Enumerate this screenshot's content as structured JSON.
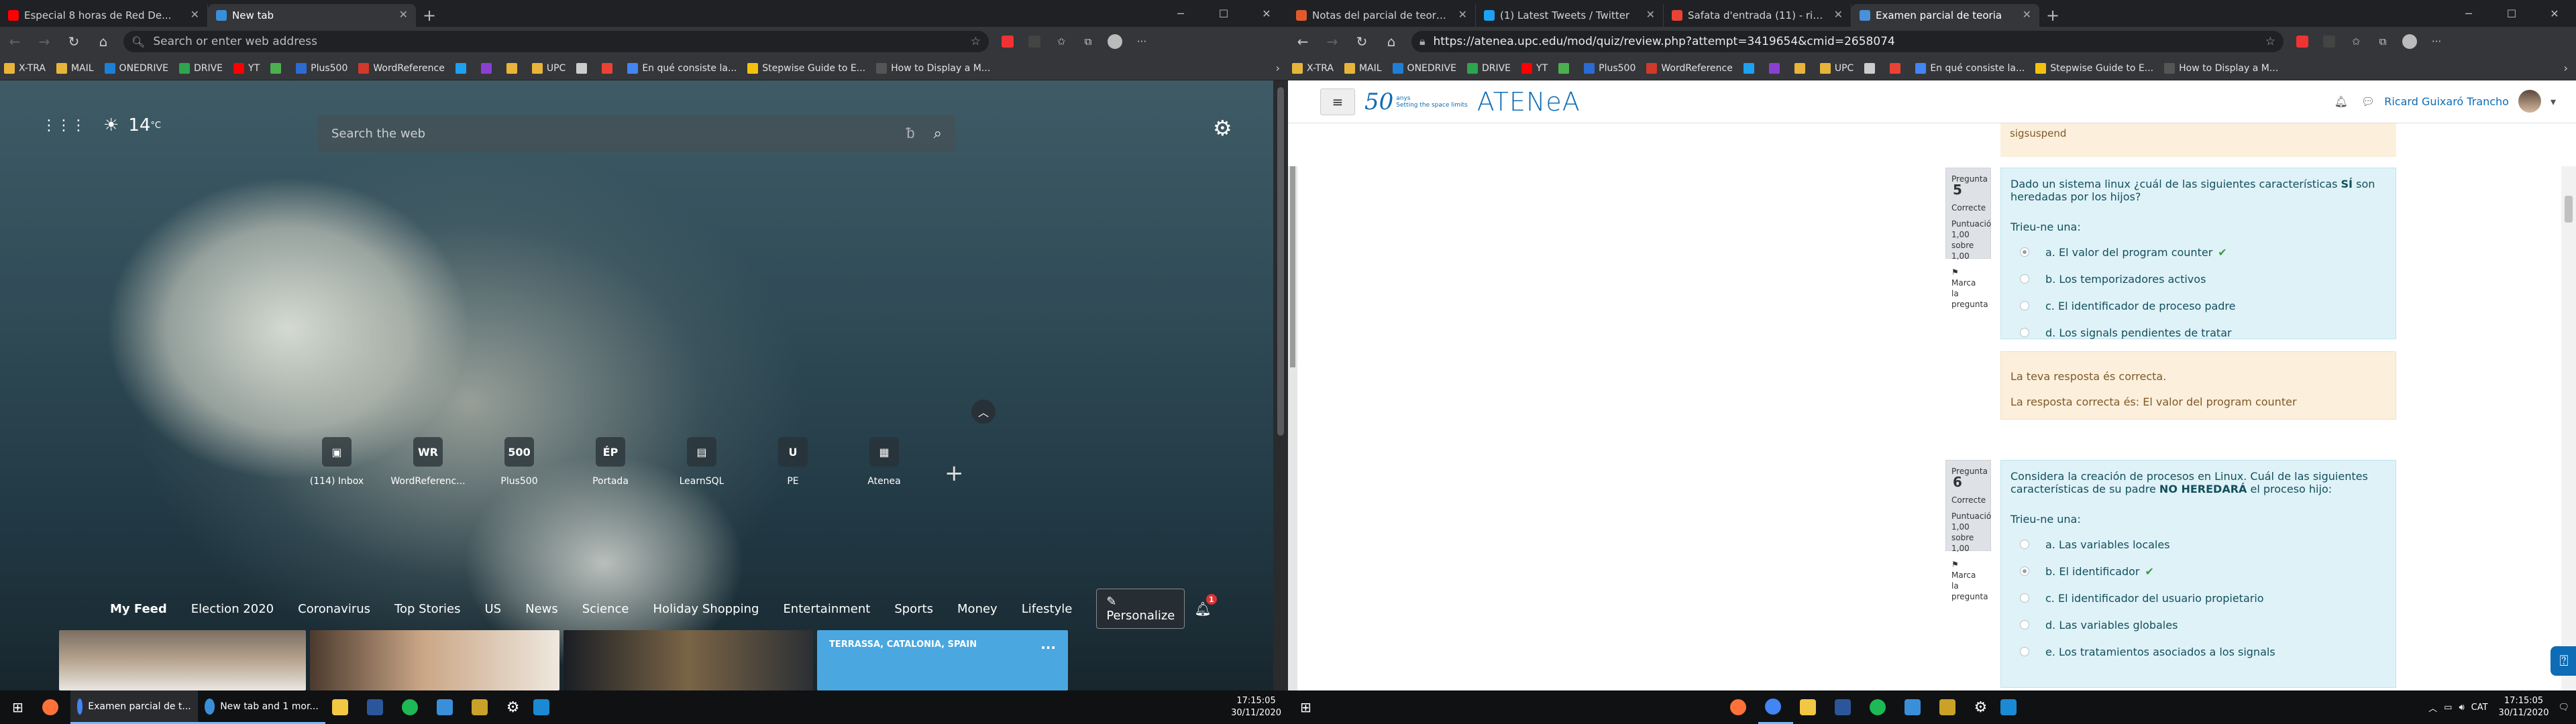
{
  "left_window": {
    "tabs": [
      {
        "label": "Especial 8 horas de Red De...",
        "color": "#ff0000",
        "active": false
      },
      {
        "label": "New tab",
        "color": "#3a8fd9",
        "active": true
      }
    ],
    "omnibox_placeholder": "Search or enter web address",
    "bookmarks": [
      {
        "label": "X-TRA",
        "color": "#e8b53a"
      },
      {
        "label": "MAIL",
        "color": "#e8b53a"
      },
      {
        "label": "ONEDRIVE",
        "color": "#1e7fd6"
      },
      {
        "label": "DRIVE",
        "color": "#2da44e"
      },
      {
        "label": "YT",
        "color": "#ff0000"
      },
      {
        "label": "",
        "color": "#4caf50"
      },
      {
        "label": "Plus500",
        "color": "#2a6bd4"
      },
      {
        "label": "WordReference",
        "color": "#d0392b"
      },
      {
        "label": "",
        "color": "#1da1f2"
      },
      {
        "label": "",
        "color": "#8b3fd1"
      },
      {
        "label": "",
        "color": "#e8b53a"
      },
      {
        "label": "UPC",
        "color": "#e8b53a"
      },
      {
        "label": "",
        "color": "#cccccc"
      },
      {
        "label": "",
        "color": "#ea4335"
      },
      {
        "label": "En qué consiste la...",
        "color": "#4285f4"
      },
      {
        "label": "Stepwise Guide to E...",
        "color": "#f4c20d"
      },
      {
        "label": "How to Display a M...",
        "color": "#555555"
      }
    ],
    "weather": {
      "temp": "14",
      "unit": "°C"
    },
    "search_placeholder": "Search the web",
    "tiles": [
      {
        "label": "(114) Inbox",
        "glyph": "▣"
      },
      {
        "label": "WordReferenc...",
        "glyph": "WR"
      },
      {
        "label": "Plus500",
        "glyph": "500"
      },
      {
        "label": "Portada",
        "glyph": "ÉP"
      },
      {
        "label": "LearnSQL",
        "glyph": "▤"
      },
      {
        "label": "PE",
        "glyph": "U"
      },
      {
        "label": "Atenea",
        "glyph": "▦"
      }
    ],
    "feed_nav": [
      "My Feed",
      "Election 2020",
      "Coronavirus",
      "Top Stories",
      "US",
      "News",
      "Science",
      "Holiday Shopping",
      "Entertainment",
      "Sports",
      "Money",
      "Lifestyle"
    ],
    "personalize_label": "Personalize",
    "notif_count": "1",
    "weather_card": {
      "location": "TERRASSA, CATALONIA, SPAIN",
      "more": "···"
    },
    "taskbar": {
      "items": [
        {
          "label": "Examen parcial de t...",
          "color": "#4285f4"
        },
        {
          "label": "New tab and 1 mor...",
          "color": "#3a8fd9"
        }
      ],
      "time": "17:15:05",
      "date": "30/11/2020"
    }
  },
  "right_window": {
    "tabs": [
      {
        "label": "Notas del parcial de teoria - Ra...",
        "color": "#e05a2b",
        "active": false
      },
      {
        "label": "(1) Latest Tweets / Twitter",
        "color": "#1da1f2",
        "active": false
      },
      {
        "label": "Safata d'entrada (11) - ricard.gu...",
        "color": "#ea4335",
        "active": false
      },
      {
        "label": "Examen parcial de teoria",
        "color": "#4a90d9",
        "active": true
      }
    ],
    "url": "https://atenea.upc.edu/mod/quiz/review.php?attempt=3419654&cmid=2658074",
    "bookmarks": [
      {
        "label": "X-TRA",
        "color": "#e8b53a"
      },
      {
        "label": "MAIL",
        "color": "#e8b53a"
      },
      {
        "label": "ONEDRIVE",
        "color": "#1e7fd6"
      },
      {
        "label": "DRIVE",
        "color": "#2da44e"
      },
      {
        "label": "YT",
        "color": "#ff0000"
      },
      {
        "label": "",
        "color": "#4caf50"
      },
      {
        "label": "Plus500",
        "color": "#2a6bd4"
      },
      {
        "label": "WordReference",
        "color": "#d0392b"
      },
      {
        "label": "",
        "color": "#1da1f2"
      },
      {
        "label": "",
        "color": "#8b3fd1"
      },
      {
        "label": "",
        "color": "#e8b53a"
      },
      {
        "label": "UPC",
        "color": "#e8b53a"
      },
      {
        "label": "",
        "color": "#cccccc"
      },
      {
        "label": "",
        "color": "#ea4335"
      },
      {
        "label": "En qué consiste la...",
        "color": "#4285f4"
      },
      {
        "label": "Stepwise Guide to E...",
        "color": "#f4c20d"
      },
      {
        "label": "How to Display a M...",
        "color": "#555555"
      }
    ],
    "logo": {
      "anys": "50",
      "anys_label": "anys",
      "tagline": "Setting the\nspace limits",
      "name": "ATENeA"
    },
    "user_name": "Ricard Guixaró Trancho",
    "prev_feedback_tail": "sigsuspend",
    "questions": [
      {
        "label": "Pregunta",
        "number": "5",
        "status": "Correcte",
        "grade": "Puntuació 1,00 sobre 1,00",
        "flag": "Marca la pregunta",
        "text_before": "Dado un sistema linux ¿cuál de las siguientes características ",
        "text_bold": "SÍ",
        "text_after": " son heredadas por los hijos?",
        "prompt": "Trieu-ne una:",
        "options": [
          {
            "label": "a. El valor del program counter",
            "selected": true,
            "correct": true
          },
          {
            "label": "b. Los temporizadores activos",
            "selected": false,
            "correct": false
          },
          {
            "label": "c. El identificador de proceso padre",
            "selected": false,
            "correct": false
          },
          {
            "label": "d. Los signals pendientes de tratar",
            "selected": false,
            "correct": false
          }
        ],
        "feedback1": "La teva resposta és correcta.",
        "feedback2": "La resposta correcta és: El valor del program counter"
      },
      {
        "label": "Pregunta",
        "number": "6",
        "status": "Correcte",
        "grade": "Puntuació 1,00 sobre 1,00",
        "flag": "Marca la pregunta",
        "text_before": "Considera la creación de procesos en Linux. Cuál de las siguientes características de su padre ",
        "text_bold": "NO HEREDARÁ",
        "text_after": " el proceso hijo:",
        "prompt": "Trieu-ne una:",
        "options": [
          {
            "label": "a. Las variables locales",
            "selected": false,
            "correct": false
          },
          {
            "label": "b. El identificador",
            "selected": true,
            "correct": true
          },
          {
            "label": "c. El identificador del usuario propietario",
            "selected": false,
            "correct": false
          },
          {
            "label": "d. Las variables globales",
            "selected": false,
            "correct": false
          },
          {
            "label": "e. Los tratamientos asociados a los signals",
            "selected": false,
            "correct": false
          }
        ]
      }
    ],
    "taskbar": {
      "lang": "CAT",
      "time": "17:15:05",
      "date": "30/11/2020"
    }
  }
}
